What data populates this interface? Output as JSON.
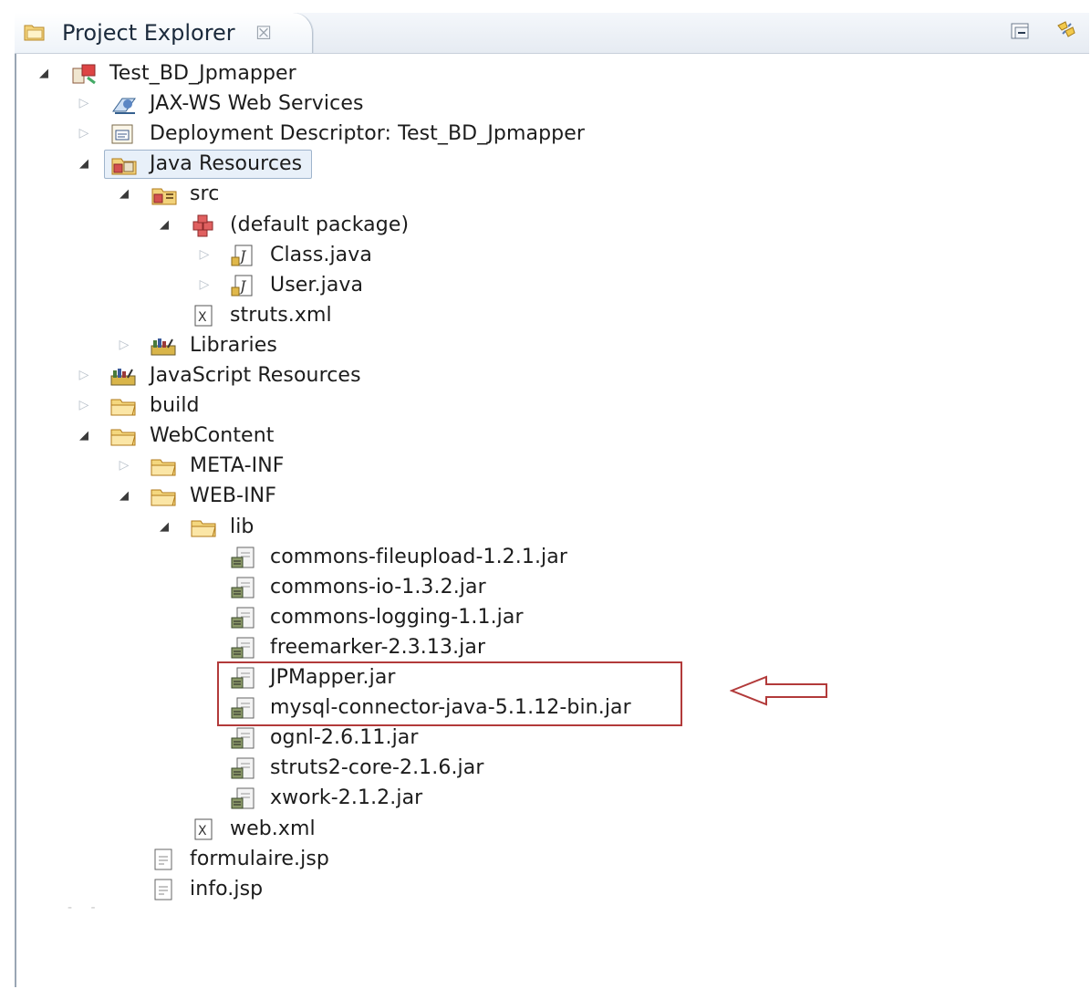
{
  "view": {
    "tab_title": "Project Explorer",
    "tab_close": "☒",
    "toolbar": {
      "collapse_icon": "collapse-all-icon",
      "link_icon": "link-with-editor-icon"
    }
  },
  "tree": [
    {
      "label": "Test_BD_Jpmapper",
      "icon": "project-icon",
      "expanded": true
    },
    {
      "label": "JAX-WS Web Services",
      "icon": "web-services-icon",
      "expanded": false
    },
    {
      "label": "Deployment Descriptor: Test_BD_Jpmapper",
      "icon": "deployment-descriptor-icon",
      "expanded": false
    },
    {
      "label": "Java Resources",
      "icon": "java-resources-icon",
      "expanded": true,
      "selected": true
    },
    {
      "label": "src",
      "icon": "source-folder-icon",
      "expanded": true
    },
    {
      "label": "(default package)",
      "icon": "package-icon",
      "expanded": true
    },
    {
      "label": "Class.java",
      "icon": "java-file-icon",
      "expanded": false
    },
    {
      "label": "User.java",
      "icon": "java-file-icon",
      "expanded": false
    },
    {
      "label": "struts.xml",
      "icon": "xml-file-icon"
    },
    {
      "label": "Libraries",
      "icon": "libraries-icon",
      "expanded": false
    },
    {
      "label": "JavaScript Resources",
      "icon": "libraries-icon",
      "expanded": false
    },
    {
      "label": "build",
      "icon": "folder-icon",
      "expanded": false
    },
    {
      "label": "WebContent",
      "icon": "folder-icon",
      "expanded": true
    },
    {
      "label": "META-INF",
      "icon": "folder-icon",
      "expanded": false
    },
    {
      "label": "WEB-INF",
      "icon": "folder-icon",
      "expanded": true
    },
    {
      "label": "lib",
      "icon": "folder-icon",
      "expanded": true
    },
    {
      "label": "commons-fileupload-1.2.1.jar",
      "icon": "jar-icon"
    },
    {
      "label": "commons-io-1.3.2.jar",
      "icon": "jar-icon"
    },
    {
      "label": "commons-logging-1.1.jar",
      "icon": "jar-icon"
    },
    {
      "label": "freemarker-2.3.13.jar",
      "icon": "jar-icon"
    },
    {
      "label": "JPMapper.jar",
      "icon": "jar-icon",
      "highlighted": true
    },
    {
      "label": "mysql-connector-java-5.1.12-bin.jar",
      "icon": "jar-icon",
      "highlighted": true
    },
    {
      "label": "ognl-2.6.11.jar",
      "icon": "jar-icon"
    },
    {
      "label": "struts2-core-2.1.6.jar",
      "icon": "jar-icon"
    },
    {
      "label": "xwork-2.1.2.jar",
      "icon": "jar-icon"
    },
    {
      "label": "web.xml",
      "icon": "xml-file-icon"
    },
    {
      "label": "formulaire.jsp",
      "icon": "jsp-file-icon"
    },
    {
      "label": "info.jsp",
      "icon": "jsp-file-icon"
    }
  ],
  "colors": {
    "highlight_border": "#b23a3a",
    "arrow": "#b23a3a",
    "selection": "#e8f0f9"
  }
}
